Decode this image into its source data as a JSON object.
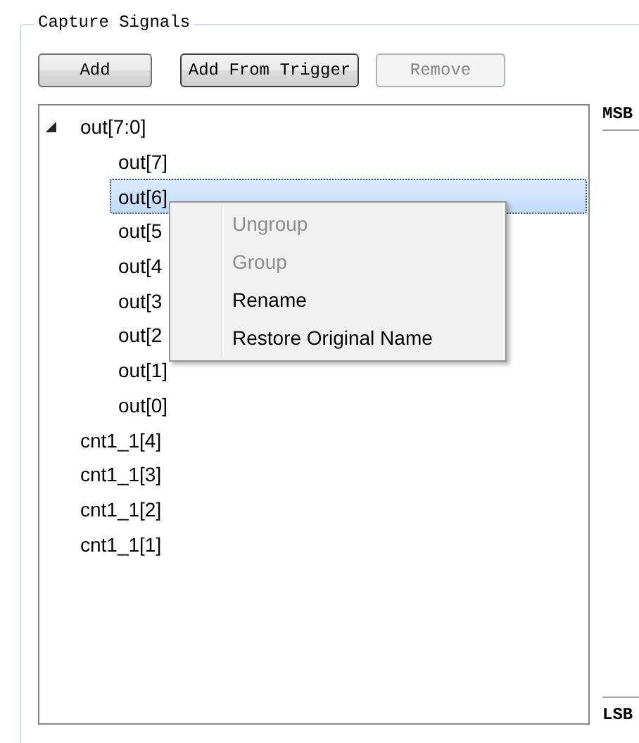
{
  "group_title": "Capture Signals",
  "buttons": [
    {
      "label": "Add",
      "disabled": false,
      "focused": false
    },
    {
      "label": "Add From Trigger",
      "disabled": false,
      "focused": true
    },
    {
      "label": "Remove",
      "disabled": true,
      "focused": false
    }
  ],
  "signals": [
    {
      "name": "out[7:0]",
      "expanded": true,
      "selected": false,
      "children": [
        {
          "name": "out[7]",
          "selected": false
        },
        {
          "name": "out[6]",
          "selected": true
        },
        {
          "name": "out[5",
          "selected": false
        },
        {
          "name": "out[4",
          "selected": false
        },
        {
          "name": "out[3",
          "selected": false
        },
        {
          "name": "out[2",
          "selected": false
        },
        {
          "name": "out[1]",
          "selected": false
        },
        {
          "name": "out[0]",
          "selected": false
        }
      ]
    },
    {
      "name": "cnt1_1[4]",
      "selected": false
    },
    {
      "name": "cnt1_1[3]",
      "selected": false
    },
    {
      "name": "cnt1_1[2]",
      "selected": false
    },
    {
      "name": "cnt1_1[1]",
      "selected": false
    }
  ],
  "context_menu": {
    "items": [
      {
        "label": "Ungroup",
        "disabled": true
      },
      {
        "label": "Group",
        "disabled": true
      },
      {
        "label": "Rename",
        "disabled": false
      },
      {
        "label": "Restore Original Name",
        "disabled": false
      }
    ]
  },
  "order_labels": {
    "top": "MSB",
    "bottom": "LSB"
  }
}
